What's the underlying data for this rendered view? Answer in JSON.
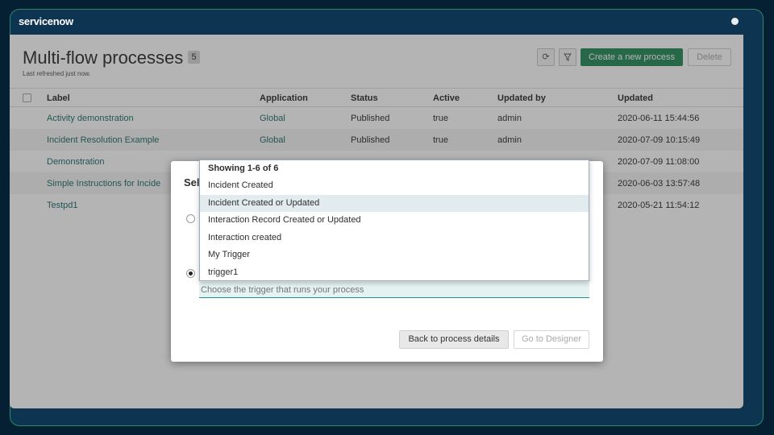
{
  "brand": {
    "logo": "servicenow"
  },
  "page": {
    "title": "Multi-flow processes",
    "count": "5",
    "refreshed": "Last refreshed just now.",
    "create_button": "Create a new process",
    "delete_button": "Delete"
  },
  "table": {
    "headers": [
      "Label",
      "Application",
      "Status",
      "Active",
      "Updated by",
      "Updated"
    ],
    "rows": [
      {
        "label": "Activity demonstration",
        "application": "Global",
        "status": "Published",
        "active": "true",
        "updated_by": "admin",
        "updated": "2020-06-11 15:44:56"
      },
      {
        "label": "Incident Resolution Example",
        "application": "Global",
        "status": "Published",
        "active": "true",
        "updated_by": "admin",
        "updated": "2020-07-09 10:15:49"
      },
      {
        "label": "Demonstration",
        "application": "",
        "status": "",
        "active": "",
        "updated_by": "",
        "updated": "2020-07-09 11:08:00"
      },
      {
        "label": "Simple Instructions for Incide",
        "application": "",
        "status": "",
        "active": "",
        "updated_by": "",
        "updated": "2020-06-03 13:57:48"
      },
      {
        "label": "Testpd1",
        "application": "",
        "status": "",
        "active": "",
        "updated_by": "",
        "updated": "2020-05-21 11:54:12"
      }
    ]
  },
  "modal": {
    "title_partial": "Sel",
    "trigger_placeholder": "Choose the trigger that runs your process",
    "back_button": "Back to process details",
    "designer_button": "Go to Designer"
  },
  "dropdown": {
    "header": "Showing 1-6 of 6",
    "highlighted_index": 1,
    "items": [
      "Incident Created",
      "Incident Created or Updated",
      "Interaction Record Created or Updated",
      "Interaction created",
      "My Trigger",
      "trigger1"
    ]
  },
  "colors": {
    "accent": "#278a5b",
    "link": "#1f6f6a",
    "frame": "#0d3450"
  }
}
